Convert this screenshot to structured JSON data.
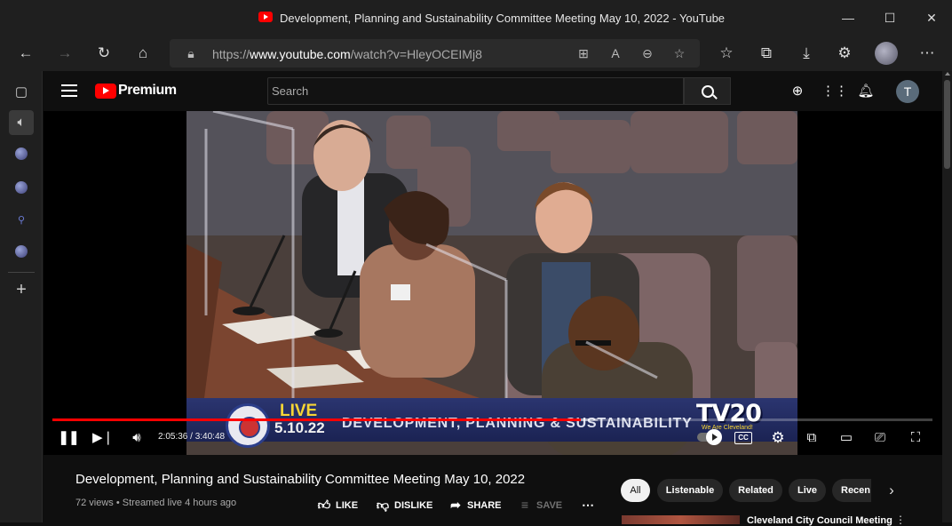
{
  "window": {
    "title": "Development, Planning and Sustainability Committee Meeting May 10, 2022 - YouTube",
    "minimize_glyph": "—",
    "maximize_glyph": "☐",
    "close_glyph": "✕"
  },
  "browser": {
    "url_prefix": "https://",
    "url_host": "www.youtube.com",
    "url_path": "/watch?v=HleyOCEIMj8"
  },
  "youtube": {
    "brand": "Premium",
    "search_placeholder": "Search",
    "user_initial": "T"
  },
  "player": {
    "progress": 0.6,
    "buffered": 0.62,
    "time_current": "2:05:36",
    "time_total": "3:40:48",
    "time_separator": " / ",
    "cc_label": "CC",
    "overlay": {
      "live": "LIVE",
      "date": "5.10.22",
      "title": "DEVELOPMENT, PLANNING & SUSTAINABILITY",
      "channel": "TV20",
      "tagline": "We Are Cleveland!"
    }
  },
  "video": {
    "title": "Development, Planning and Sustainability Committee Meeting May 10, 2022",
    "views": "72 views",
    "bullet": " • ",
    "streamed": "Streamed live 4 hours ago",
    "actions": {
      "like": "LIKE",
      "dislike": "DISLIKE",
      "share": "SHARE",
      "save": "SAVE"
    }
  },
  "chips": [
    "All",
    "Listenable",
    "Related",
    "Live",
    "Recen"
  ],
  "recommendation": {
    "title": "Cleveland City Council Meeting"
  },
  "icons": {
    "back": "back-arrow-icon",
    "forward": "forward-arrow-icon",
    "refresh": "refresh-icon",
    "home": "home-icon"
  }
}
